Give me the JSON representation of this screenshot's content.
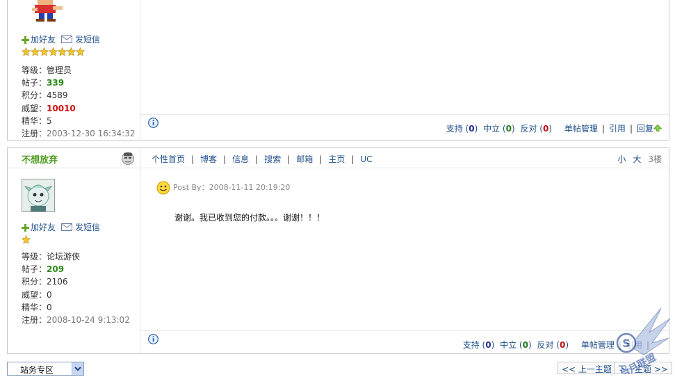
{
  "posts": [
    {
      "add_friend": "加好友",
      "send_msg": "发短信",
      "star_count": 7,
      "stats": {
        "level_label": "等级：",
        "level": "管理员",
        "posts_label": "帖子：",
        "posts": "339",
        "points_label": "积分：",
        "points": "4589",
        "prestige_label": "威望：",
        "prestige": "10010",
        "essence_label": "精华：",
        "essence": "5",
        "registered_label": "注册：",
        "registered": "2003-12-30 16:34:32"
      },
      "footer": {
        "support": "支持",
        "support_count": "0",
        "neutral": "中立",
        "neutral_count": "0",
        "oppose": "反对",
        "oppose_count": "0",
        "manage": "单帖管理",
        "quote": "引用",
        "reply": "回复"
      }
    },
    {
      "username": "不想放弃",
      "add_friend": "加好友",
      "send_msg": "发短信",
      "star_count": 1,
      "tabs": [
        "个性首页",
        "博客",
        "信息",
        "搜索",
        "邮箱",
        "主页",
        "UC"
      ],
      "size_small": "小",
      "size_large": "大",
      "floor": "3楼",
      "post_by": "Post By：2008-11-11 20:19:20",
      "content": "谢谢。我已收到您的付款。。。谢谢！！！",
      "stats": {
        "level_label": "等级：",
        "level": "论坛游侠",
        "posts_label": "帖子：",
        "posts": "209",
        "points_label": "积分：",
        "points": "2106",
        "prestige_label": "威望：",
        "prestige": "0",
        "essence_label": "精华：",
        "essence": "0",
        "registered_label": "注册：",
        "registered": "2008-10-24 9:13:02"
      },
      "footer": {
        "support": "支持",
        "support_count": "0",
        "neutral": "中立",
        "neutral_count": "0",
        "oppose": "反对",
        "oppose_count": "0",
        "manage": "单帖管理",
        "quote": "引用"
      }
    }
  ],
  "bottom": {
    "forum_select": "站务专区",
    "prev_topic": "<< 上一主题",
    "next_topic": "下一主题 >>"
  },
  "watermark": "当月联盟",
  "icons": [
    "plus-icon",
    "mail-icon",
    "star-icon",
    "info-icon",
    "up-arrow-icon",
    "smiley-icon",
    "chevron-down-icon"
  ],
  "colors": {
    "link": "#1f4e8a",
    "username": "#4a9a1a",
    "posts_value": "#2a8a1a",
    "prestige_value": "#d01010",
    "border": "#c9c9c9"
  }
}
